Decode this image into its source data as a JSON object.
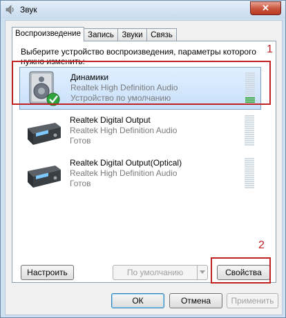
{
  "window": {
    "title": "Звук"
  },
  "tabs": [
    {
      "label": "Воспроизведение",
      "active": true
    },
    {
      "label": "Запись",
      "active": false
    },
    {
      "label": "Звуки",
      "active": false
    },
    {
      "label": "Связь",
      "active": false
    }
  ],
  "instruction": "Выберите устройство воспроизведения, параметры которого нужно изменить:",
  "devices": [
    {
      "name": "Динамики",
      "driver": "Realtek High Definition Audio",
      "status": "Устройство по умолчанию",
      "icon": "speaker-icon",
      "selected": true,
      "level": 0.15
    },
    {
      "name": "Realtek Digital Output",
      "driver": "Realtek High Definition Audio",
      "status": "Готов",
      "icon": "digital-output-icon",
      "selected": false,
      "level": 0
    },
    {
      "name": "Realtek Digital Output(Optical)",
      "driver": "Realtek High Definition Audio",
      "status": "Готов",
      "icon": "digital-output-icon",
      "selected": false,
      "level": 0
    }
  ],
  "buttons": {
    "configure": "Настроить",
    "set_default": "По умолчанию",
    "properties": "Свойства",
    "ok": "ОК",
    "cancel": "Отмена",
    "apply": "Применить"
  },
  "annotations": {
    "one": "1",
    "two": "2"
  },
  "colors": {
    "annotation": "#c02020",
    "meter_on": "#3fa73f",
    "selection": "#c8e0fa"
  }
}
